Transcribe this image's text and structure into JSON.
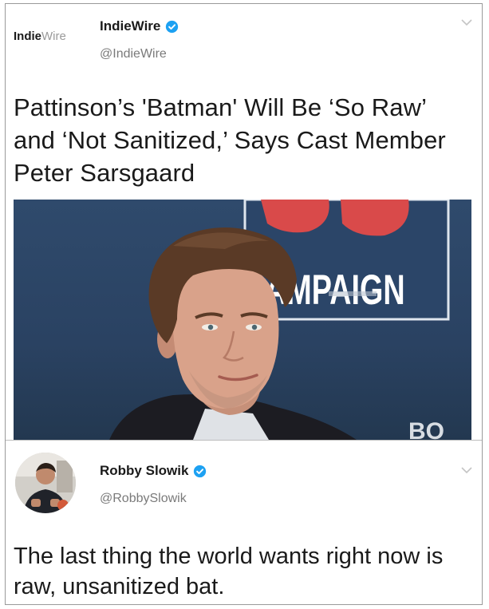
{
  "tweet1": {
    "avatar_logo": {
      "part1": "Indie",
      "part2": "Wire"
    },
    "name": "IndieWire",
    "handle": "@IndieWire",
    "text": "Pattinson’s 'Batman' Will Be ‘So Raw’ and ‘Not Sanitized,’ Says Cast Member Peter Sarsgaard",
    "image": {
      "backdrop_text": "AMPAIGN",
      "backdrop_letters": "BO",
      "icon": "person-photo"
    }
  },
  "tweet2": {
    "name": "Robby Slowik",
    "handle": "@RobbySlowik",
    "text": "The last thing the world wants right now is raw, unsanitized bat."
  },
  "icons": {
    "verified": "verified-badge-icon",
    "menu": "chevron-down-icon"
  },
  "colors": {
    "verified": "#1da1f2",
    "backdrop": "#2e4768",
    "accent_red": "#d94a4a"
  }
}
